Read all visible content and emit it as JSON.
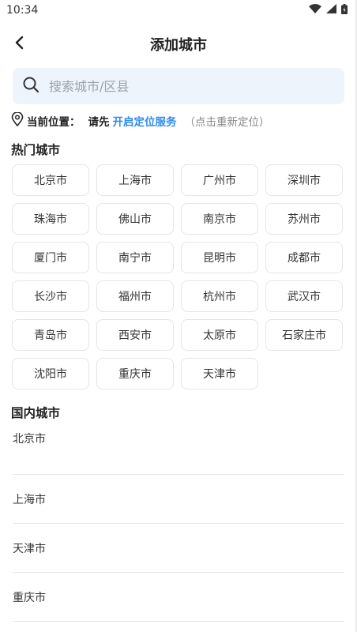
{
  "status": {
    "time": "10:34"
  },
  "header": {
    "title": "添加城市"
  },
  "search": {
    "placeholder": "搜索城市/区县"
  },
  "location": {
    "label": "当前位置：",
    "prefix": "请先",
    "link": "开启定位服务",
    "hint": "（点击重新定位）"
  },
  "hot": {
    "title": "热门城市",
    "cities": [
      "北京市",
      "上海市",
      "广州市",
      "深圳市",
      "珠海市",
      "佛山市",
      "南京市",
      "苏州市",
      "厦门市",
      "南宁市",
      "昆明市",
      "成都市",
      "长沙市",
      "福州市",
      "杭州市",
      "武汉市",
      "青岛市",
      "西安市",
      "太原市",
      "石家庄市",
      "沈阳市",
      "重庆市",
      "天津市"
    ]
  },
  "domestic": {
    "title": "国内城市",
    "cities": [
      "北京市",
      "上海市",
      "天津市",
      "重庆市"
    ]
  }
}
